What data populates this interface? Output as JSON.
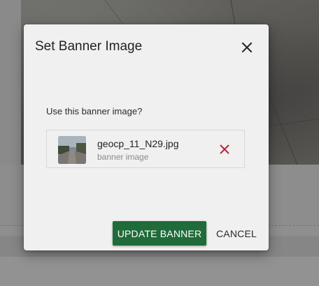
{
  "dialog": {
    "title": "Set Banner Image",
    "close_icon": "close-icon",
    "prompt": "Use this banner image?",
    "file": {
      "name": "geocp_11_N29.jpg",
      "subtitle": "banner image",
      "remove_icon": "remove-icon"
    },
    "buttons": {
      "update_label": "UPDATE BANNER",
      "cancel_label": "CANCEL"
    }
  },
  "colors": {
    "primary": "#1f6b3a",
    "remove": "#b5253a",
    "dialog_bg": "#f0f0f0"
  }
}
